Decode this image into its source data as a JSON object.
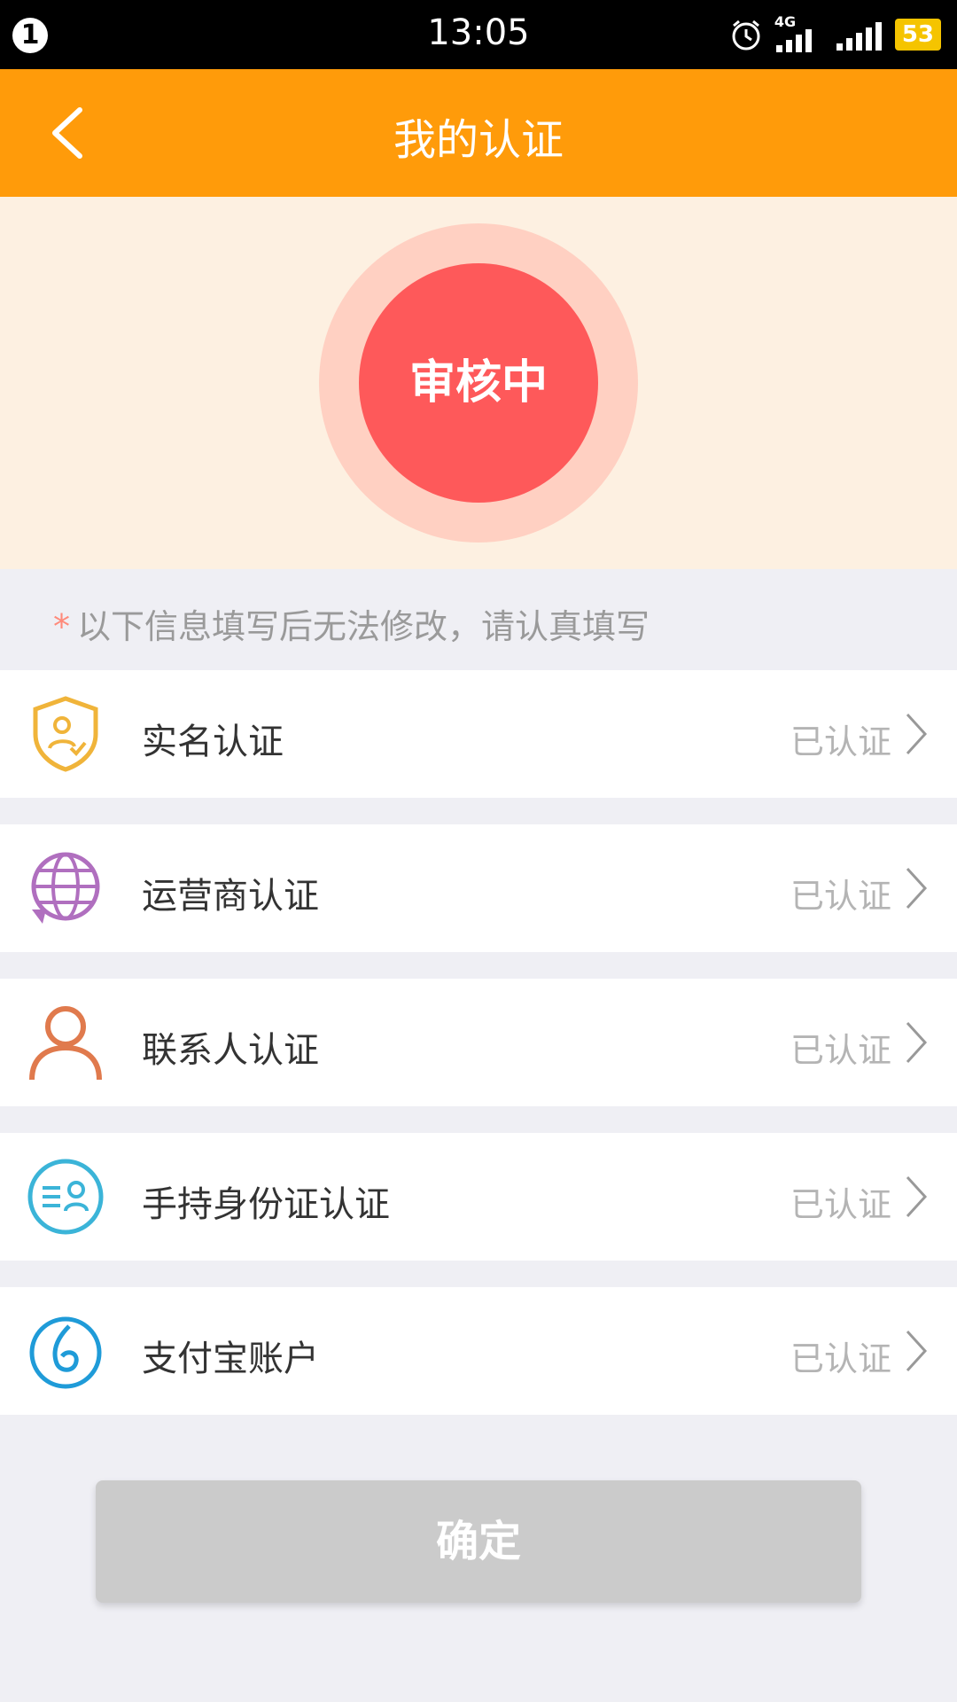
{
  "status_bar": {
    "badge": "1",
    "time": "13:05",
    "network": "4G",
    "battery": "53"
  },
  "app_bar": {
    "title": "我的认证"
  },
  "hero": {
    "status": "审核中"
  },
  "notice": {
    "star": "*",
    "text": "以下信息填写后无法修改，请认真填写"
  },
  "items": [
    {
      "label": "实名认证",
      "status": "已认证",
      "icon": "shield-id-icon",
      "color": "#f0b43a"
    },
    {
      "label": "运营商认证",
      "status": "已认证",
      "icon": "globe-sync-icon",
      "color": "#b06fbf"
    },
    {
      "label": "联系人认证",
      "status": "已认证",
      "icon": "person-icon",
      "color": "#e07a4d"
    },
    {
      "label": "手持身份证认证",
      "status": "已认证",
      "icon": "id-card-icon",
      "color": "#3bb4d8"
    },
    {
      "label": "支付宝账户",
      "status": "已认证",
      "icon": "alipay-icon",
      "color": "#1f9bd8"
    }
  ],
  "confirm_button": {
    "label": "确定"
  },
  "colors": {
    "accent": "#ff9b0a",
    "status_red": "#fe595a"
  }
}
